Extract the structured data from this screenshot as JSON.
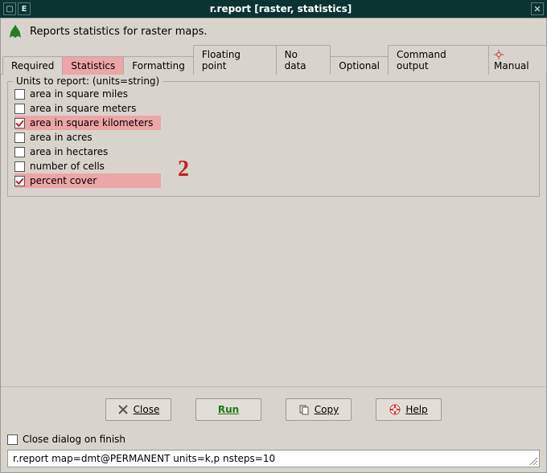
{
  "window": {
    "title": "r.report [raster, statistics]",
    "description": "Reports statistics for raster maps."
  },
  "tabs": [
    {
      "id": "required",
      "label": "Required"
    },
    {
      "id": "statistics",
      "label": "Statistics"
    },
    {
      "id": "formatting",
      "label": "Formatting"
    },
    {
      "id": "floating",
      "label": "Floating point"
    },
    {
      "id": "nodata",
      "label": "No data"
    },
    {
      "id": "optional",
      "label": "Optional"
    },
    {
      "id": "output",
      "label": "Command output"
    },
    {
      "id": "manual",
      "label": "Manual"
    }
  ],
  "active_tab": "statistics",
  "panel": {
    "legend": "Units to report:  (units=string)",
    "options": [
      {
        "key": "mi",
        "label": "area in square miles",
        "checked": false,
        "highlight": false
      },
      {
        "key": "me",
        "label": "area in square meters",
        "checked": false,
        "highlight": false
      },
      {
        "key": "k",
        "label": "area in square kilometers",
        "checked": true,
        "highlight": true
      },
      {
        "key": "a",
        "label": "area in acres",
        "checked": false,
        "highlight": false
      },
      {
        "key": "h",
        "label": "area in hectares",
        "checked": false,
        "highlight": false
      },
      {
        "key": "c",
        "label": "number of cells",
        "checked": false,
        "highlight": false
      },
      {
        "key": "p",
        "label": "percent cover",
        "checked": true,
        "highlight": true
      }
    ]
  },
  "annotation": {
    "number": "2"
  },
  "buttons": {
    "close": "Close",
    "run": "Run",
    "copy": "Copy",
    "help": "Help"
  },
  "close_on_finish": {
    "label": "Close dialog on finish",
    "checked": false
  },
  "command": "r.report map=dmt@PERMANENT units=k,p nsteps=10"
}
